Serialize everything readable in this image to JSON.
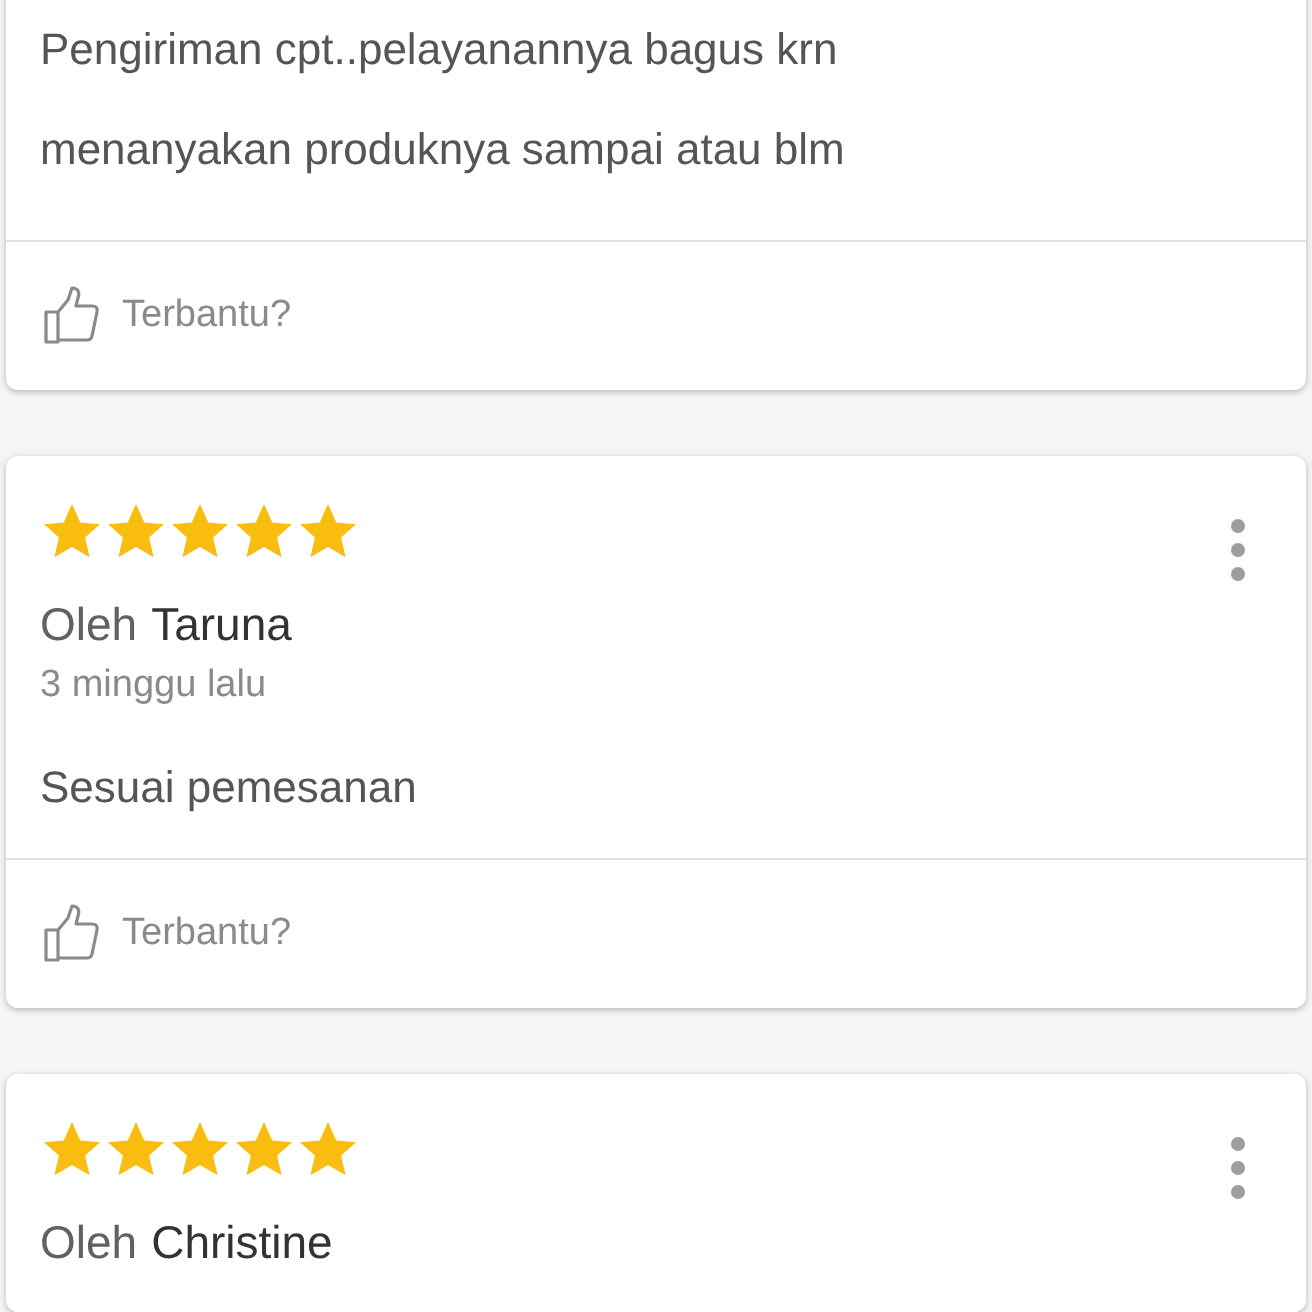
{
  "reviews": [
    {
      "text": "Pengiriman cpt..pelayanannya bagus krn menanyakan produknya sampai atau blm",
      "helpful_label": "Terbantu?"
    },
    {
      "stars": 5,
      "author_prefix": "Oleh",
      "author": "Taruna",
      "time": "3 minggu lalu",
      "text": "Sesuai pemesanan",
      "helpful_label": "Terbantu?"
    },
    {
      "stars": 5,
      "author_prefix": "Oleh",
      "author": "Christine"
    }
  ]
}
